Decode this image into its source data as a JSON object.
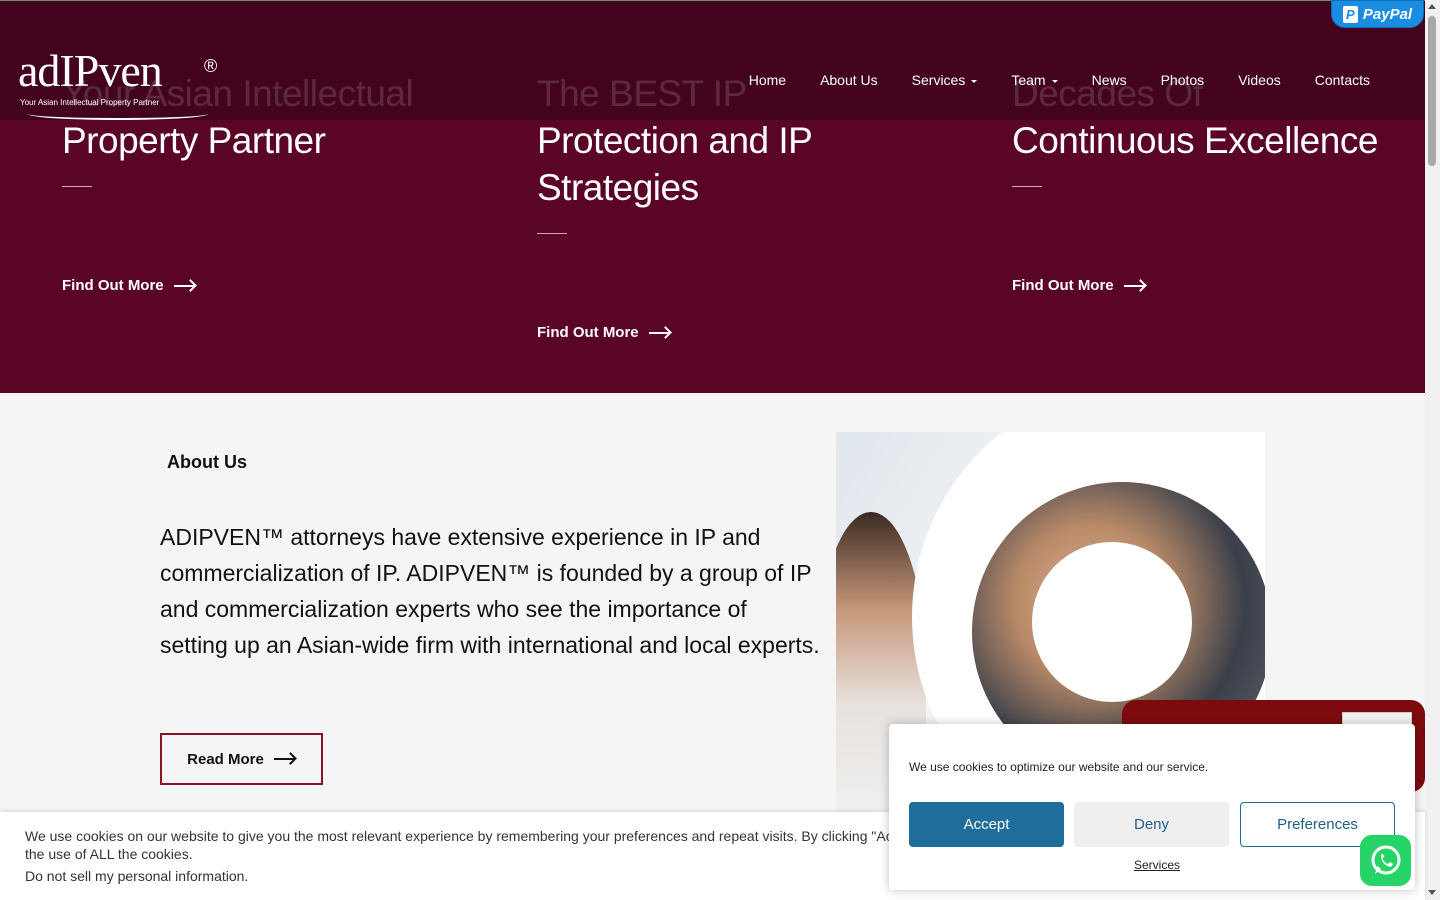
{
  "logo": {
    "word": "adIPven",
    "registered": "®",
    "tagline": "Your Asian Intellectual Property Partner"
  },
  "nav": {
    "items": [
      {
        "label": "Home"
      },
      {
        "label": "About Us"
      },
      {
        "label": "Services"
      },
      {
        "label": "Team"
      },
      {
        "label": "News"
      },
      {
        "label": "Photos"
      },
      {
        "label": "Videos"
      },
      {
        "label": "Contacts"
      }
    ]
  },
  "paypal": {
    "label": "PayPal"
  },
  "slides": [
    {
      "title": "Your Asian Intellectual Property Partner",
      "cta": "Find Out More"
    },
    {
      "title": "The BEST IP Protection and IP Strategies",
      "cta": "Find Out More"
    },
    {
      "title": "Decades Of Continuous Excellence",
      "cta": "Find Out More"
    }
  ],
  "about": {
    "label": "About Us",
    "text": "ADIPVEN™ attorneys have extensive experience in IP and commercialization of IP. ADIPVEN™ is founded by a group of IP and commercialization experts who see the importance of setting up an Asian-wide firm with international and local experts.",
    "read_more": "Read More"
  },
  "cookie_bar": {
    "text": "We use cookies on our website to give you the most relevant experience by remembering your preferences and repeat visits. By clicking \"Accept\", you consent to the use of ALL the cookies.",
    "do_not_sell": "Do not sell my personal information."
  },
  "consent": {
    "message": "We use cookies to optimize our website and our service.",
    "accept": "Accept",
    "deny": "Deny",
    "preferences": "Preferences",
    "services": "Services"
  },
  "colors": {
    "hero_bg": "#5a0426",
    "accent": "#8a1027",
    "accept_btn": "#1e6d9a",
    "whatsapp": "#25d366",
    "chat_widget": "#7d0b0e"
  }
}
